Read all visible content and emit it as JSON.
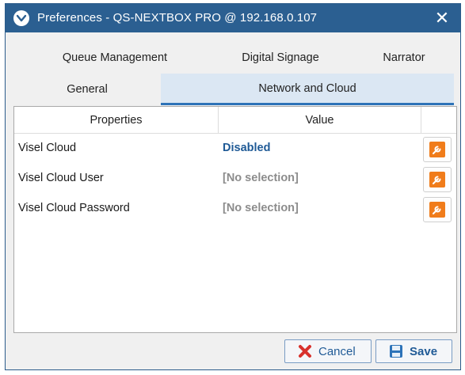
{
  "window": {
    "title": "Preferences - QS-NEXTBOX PRO @ 192.168.0.107",
    "close_glyph": "✕"
  },
  "tabs": {
    "row1": [
      {
        "label": "Queue Management",
        "active": false
      },
      {
        "label": "Digital Signage",
        "active": false
      },
      {
        "label": "Narrator",
        "active": false
      }
    ],
    "row2": [
      {
        "label": "General",
        "active": false
      },
      {
        "label": "Network and Cloud",
        "active": true
      }
    ]
  },
  "grid": {
    "headers": {
      "properties": "Properties",
      "value": "Value"
    },
    "rows": [
      {
        "property": "Visel Cloud",
        "value": "Disabled"
      },
      {
        "property": "Visel Cloud User",
        "value": "[No selection]"
      },
      {
        "property": "Visel Cloud Password",
        "value": "[No selection]"
      }
    ]
  },
  "footer": {
    "cancel_label": "Cancel",
    "save_label": "Save"
  },
  "colors": {
    "titlebar": "#2b5f91",
    "accent": "#1f5a96",
    "wrench": "#f07c1a",
    "cancel_x": "#d8312c"
  }
}
